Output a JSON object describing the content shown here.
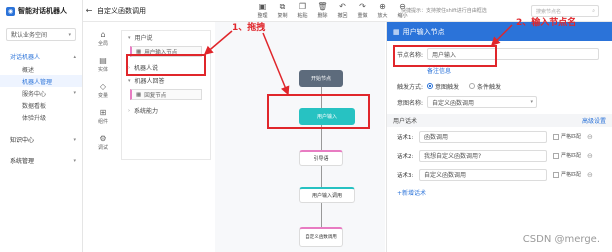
{
  "app": {
    "logo_text": "智能对话机器人",
    "biz_select": "默认业务空间",
    "page_title": "自定义函数调用"
  },
  "sidebar": {
    "groups": [
      {
        "label": "对话机器人",
        "active": true,
        "items": [
          "概述",
          "机器人管理",
          "服务中心",
          "数据看板",
          "体验升级"
        ]
      },
      {
        "label": "知识中心",
        "active": false,
        "items": []
      },
      {
        "label": "系统管理",
        "active": false,
        "items": []
      }
    ]
  },
  "toolbar": {
    "tools": [
      {
        "icon": "save-icon",
        "glyph": "▣",
        "label": "整理"
      },
      {
        "icon": "copy-icon",
        "glyph": "⧉",
        "label": "复制"
      },
      {
        "icon": "paste-icon",
        "glyph": "❐",
        "label": "粘贴"
      },
      {
        "icon": "delete-icon",
        "glyph": "🗑",
        "label": "删除"
      },
      {
        "icon": "undo-icon",
        "glyph": "↶",
        "label": "撤回"
      },
      {
        "icon": "redo-icon",
        "glyph": "↷",
        "label": "重做"
      },
      {
        "icon": "zoom-in-icon",
        "glyph": "⊕",
        "label": "放大"
      },
      {
        "icon": "zoom-out-icon",
        "glyph": "⊖",
        "label": "缩小"
      }
    ],
    "hint": "快捷提示：支持按住shift进行自由框选",
    "search_placeholder": "搜索节点名"
  },
  "iconstrip": [
    {
      "icon": "home-icon",
      "glyph": "⌂",
      "label": "全局"
    },
    {
      "icon": "card-icon",
      "glyph": "▤",
      "label": "实体"
    },
    {
      "icon": "variable-icon",
      "glyph": "◇",
      "label": "变量"
    },
    {
      "icon": "component-icon",
      "glyph": "⊞",
      "label": "组件"
    },
    {
      "icon": "debug-icon",
      "glyph": "⚙",
      "label": "调试"
    }
  ],
  "library": {
    "sections": [
      "用户说",
      "机器人说",
      "机器人回答",
      "系统能力"
    ],
    "nodes": {
      "user_input": "用户输入节点",
      "reply": "回复节点"
    }
  },
  "canvas": {
    "nodes": {
      "start": "开始节点",
      "user_input": "用户输入",
      "guide": "引导语",
      "user_input_tip": "用户输入调用",
      "custom": "自定义函数调用"
    }
  },
  "props": {
    "header": "用户输入节点",
    "node_name_label": "节点名称:",
    "node_name_value": "用户输入",
    "remark_link": "备注信息",
    "trigger_label": "触发方式:",
    "trigger_options": [
      "意图触发",
      "条件触发"
    ],
    "intent_label": "意图名称:",
    "intent_value": "自定义函数调用",
    "utter_section": "用户话术",
    "utter_action": "高级设置",
    "utterances": [
      {
        "label": "话术1:",
        "value": "函数调用"
      },
      {
        "label": "话术2:",
        "value": "我想自定义函数调用?"
      },
      {
        "label": "话术3:",
        "value": "自定义函数调用"
      }
    ],
    "strict_label": "严格匹配",
    "add_link": "+新增话术"
  },
  "annotations": {
    "a1": "1、拖拽",
    "a2": "2、输入节点名"
  },
  "watermark": "CSDN @merge."
}
